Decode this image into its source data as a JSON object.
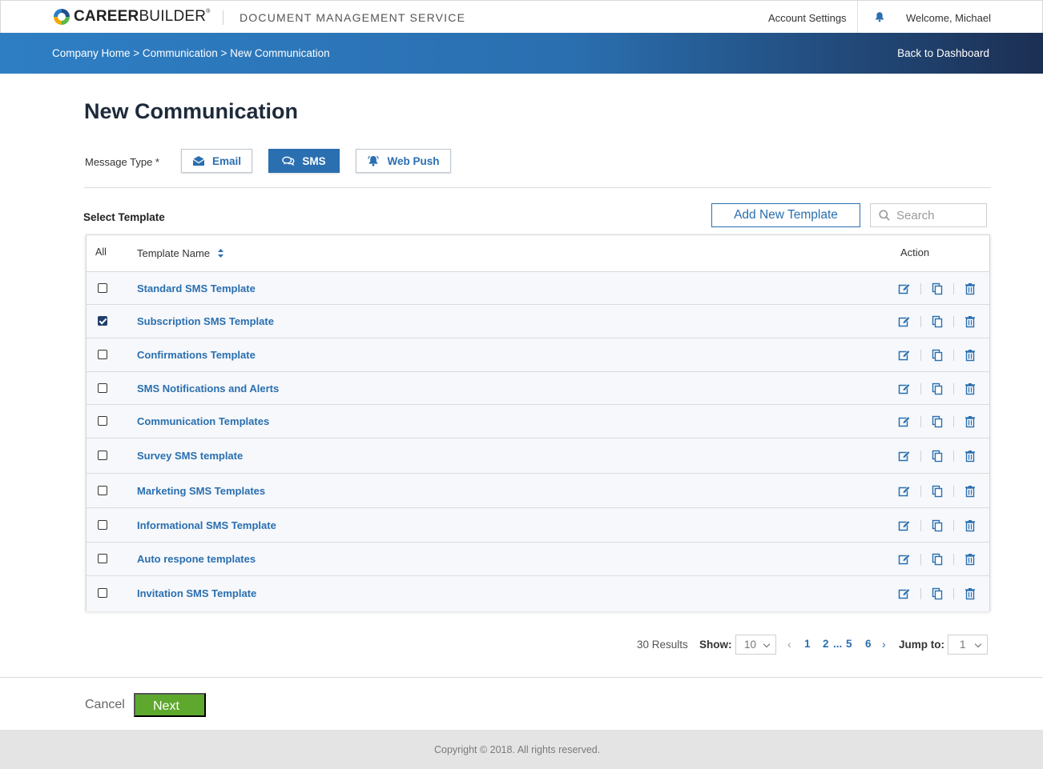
{
  "header": {
    "logo_text_bold": "CAREER",
    "logo_text_regular": "BUILDER",
    "logo_mark": "®",
    "service_name": "DOCUMENT MANAGEMENT SERVICE",
    "account_settings": "Account Settings",
    "notifications_icon": "bell-icon",
    "welcome": "Welcome, Michael"
  },
  "subheader": {
    "breadcrumb": "Company Home > Communication > New Communication",
    "back_link": "Back to Dashboard",
    "gradient_start": "#2e7ec4",
    "gradient_end": "#1c2f53"
  },
  "page": {
    "title": "New Communication",
    "message_type_label": "Message Type *",
    "message_types": [
      {
        "label": "Email",
        "icon": "envelope-icon",
        "active": false
      },
      {
        "label": "SMS",
        "icon": "chat-bubbles-icon",
        "active": true
      },
      {
        "label": "Web Push",
        "icon": "bell-icon",
        "active": false
      }
    ]
  },
  "templates": {
    "section_label": "Select Template",
    "add_button": "Add New Template",
    "search_placeholder": "Search",
    "columns": {
      "all": "All",
      "name": "Template Name",
      "action": "Action"
    },
    "rows": [
      {
        "name": "Standard SMS Template",
        "checked": false
      },
      {
        "name": "Subscription SMS Template",
        "checked": true
      },
      {
        "name": "Confirmations Template",
        "checked": false
      },
      {
        "name": "SMS Notifications and Alerts",
        "checked": false
      },
      {
        "name": "Communication Templates",
        "checked": false
      },
      {
        "name": "Survey SMS template",
        "checked": false
      },
      {
        "name": "Marketing SMS Templates",
        "checked": false
      },
      {
        "name": "Informational SMS Template",
        "checked": false
      },
      {
        "name": "Auto respone templates",
        "checked": false
      },
      {
        "name": "Invitation SMS Template",
        "checked": false
      }
    ],
    "row_actions": [
      "edit-icon",
      "copy-icon",
      "trash-icon"
    ]
  },
  "pagination": {
    "results": "30 Results",
    "show_label": "Show:",
    "show_value": "10",
    "prev": "‹",
    "pages": [
      "1",
      "2",
      "...",
      "5",
      "6"
    ],
    "next": "›",
    "jump_label": "Jump to:",
    "jump_value": "1"
  },
  "actions": {
    "cancel": "Cancel",
    "next": "Next",
    "next_color": "#5ea82e"
  },
  "footer": {
    "copyright": "Copyright © 2018. All rights reserved."
  },
  "colors": {
    "accent": "#2a6fb0",
    "title": "#1d2a3a"
  }
}
